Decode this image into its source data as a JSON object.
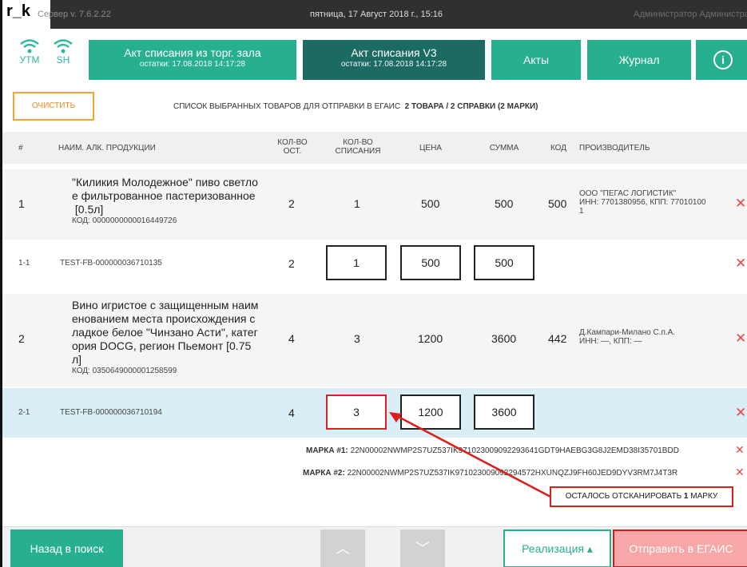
{
  "titlebar": {
    "logo": "r_k",
    "version": "Сервер v. 7.6.2.22",
    "datetime": "пятница, 17 Август 2018 г., 15:16",
    "user": "Администратор Администратор"
  },
  "status": {
    "utm_label": "УТМ",
    "sh_label": "SH"
  },
  "tabs": [
    {
      "label": "Акт списания из торг. зала",
      "sub": "остатки: 17.08.2018 14:17:28"
    },
    {
      "label": "Акт списания V3",
      "sub": "остатки: 17.08.2018 14:17:28"
    },
    {
      "label": "Акты"
    },
    {
      "label": "Журнал"
    }
  ],
  "info_icon": "i",
  "toolbar": {
    "clear_label": "ОЧИСТИТЬ",
    "summary_text": "СПИСОК ВЫБРАННЫХ ТОВАРОВ ДЛЯ ОТПРАВКИ В ЕГАИС",
    "summary_bold": "2 ТОВАРА / 2 СПРАВКИ (2 МАРКИ)"
  },
  "table": {
    "headers": {
      "num": "#",
      "name": "НАИМ. АЛК. ПРОДУКЦИИ",
      "qty_left_1": "КОЛ-ВО",
      "qty_left_2": "ОСТ.",
      "qty_write_1": "КОЛ-ВО",
      "qty_write_2": "СПИСАНИЯ",
      "price": "ЦЕНА",
      "sum": "СУММА",
      "code": "КОД",
      "maker": "ПРОИЗВОДИТЕЛЬ"
    },
    "rows": [
      {
        "num": "1",
        "name_lines": [
          "\"Киликия Молодежное\" пиво светло",
          "е фильтрованное пастеризованное",
          " [0.5л]"
        ],
        "code_line": "КОД: 0000000000016449726",
        "qty_left": "2",
        "qty_write": "1",
        "price": "500",
        "sum": "500",
        "code": "500",
        "maker_lines": [
          "ООО \"ПЕГАС ЛОГИСТИК\"",
          "ИНН: 7701380956, КПП: 77010100",
          "1"
        ]
      },
      {
        "num": "1-1",
        "name": "TEST-FB-000000036710135",
        "qty_left": "2",
        "qty_write": "1",
        "price": "500",
        "sum": "500"
      },
      {
        "num": "2",
        "name_lines": [
          "Вино игристое с защищенным наим",
          "енованием места происхождения с",
          "ладкое белое \"Чинзано Асти\", катег",
          "ория DOCG, регион Пьемонт  [0.75",
          "л]"
        ],
        "code_line": "КОД: 0350649000001258599",
        "qty_left": "4",
        "qty_write": "3",
        "price": "1200",
        "sum": "3600",
        "code": "442",
        "maker_lines": [
          "Д.Кампари-Милано С.п.А.",
          "ИНН: —, КПП: —"
        ]
      },
      {
        "num": "2-1",
        "name": "TEST-FB-000000036710194",
        "qty_left": "4",
        "qty_write": "3",
        "price": "1200",
        "sum": "3600"
      }
    ],
    "delete_icon": "✕"
  },
  "marks": [
    {
      "label": "МАРКА #1:",
      "value": "22N00002NWMP2S7UZ537IK971023009092293641GDT9HAEBG3G8J2EMD38I35701BDD"
    },
    {
      "label": "МАРКА #2:",
      "value": "22N00002NWMP2S7UZ537IK971023009092294572HXUNQZJ9FH60JED9DYV3RM7J4T3R"
    }
  ],
  "callout": {
    "prefix": "ОСТАЛОСЬ ОТСКАНИРОВАТЬ",
    "count": "1",
    "suffix": "МАРКУ"
  },
  "footer": {
    "back_label": "Назад в поиск",
    "up_icon": "︿",
    "down_icon": "﹀",
    "realization_label": "Реализация ▴",
    "send_label": "Отправить в ЕГАИС"
  },
  "colors": {
    "accent": "#27b08f",
    "accent_dark": "#1c6b63",
    "danger": "#e02020",
    "warning": "#f2a33b"
  }
}
